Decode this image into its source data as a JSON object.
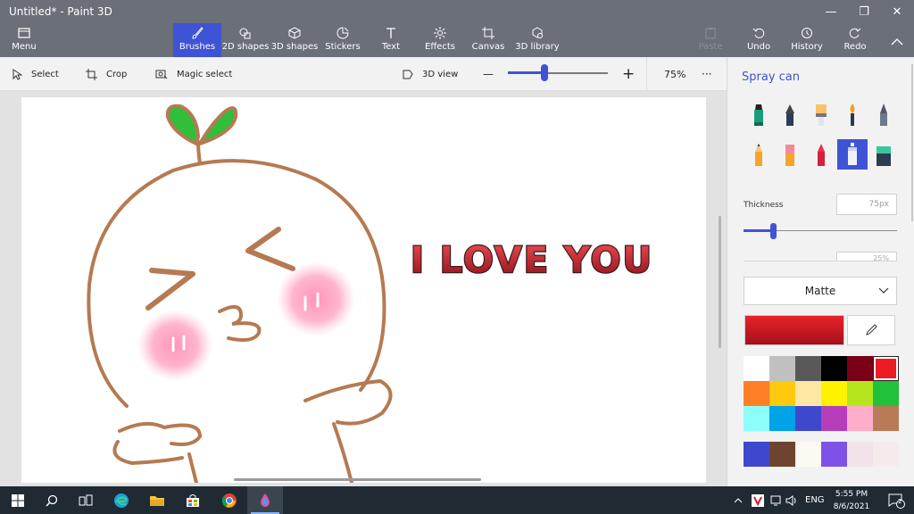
{
  "window": {
    "title": "Untitled* - Paint 3D",
    "minimize_glyph": "—",
    "maximize_glyph": "❐",
    "close_glyph": "✕"
  },
  "ribbon": {
    "menu": "Menu",
    "tabs": [
      "Brushes",
      "2D shapes",
      "3D shapes",
      "Stickers",
      "Text",
      "Effects",
      "Canvas",
      "3D library"
    ],
    "active_tab": "Brushes",
    "paste": "Paste",
    "undo": "Undo",
    "history": "History",
    "redo": "Redo"
  },
  "toolbar": {
    "select": "Select",
    "crop": "Crop",
    "magic_select": "Magic select",
    "view_3d": "3D view",
    "zoom_minus": "—",
    "zoom_plus": "+",
    "zoom_level": "75%",
    "more": "···",
    "zoom_fraction": 0.37
  },
  "canvas": {
    "text_art": "I LOVE YOU"
  },
  "panel": {
    "title": "Spray can",
    "brushes": [
      "marker",
      "calligraphy-pen",
      "oil-brush",
      "watercolor",
      "pixel-pen",
      "pencil",
      "eraser",
      "crayon",
      "spray-can",
      "fill"
    ],
    "selected_brush": "spray-can",
    "thickness_label": "Thickness",
    "thickness_value": "75px",
    "thickness_fraction": 0.2,
    "opacity_peek": "25%",
    "finish": "Matte",
    "current_color": "#e8232a",
    "palette": [
      "#ffffff",
      "#c0c0c0",
      "#595959",
      "#000000",
      "#7a0017",
      "#ed1c24",
      "#ff7f27",
      "#ffc90e",
      "#fce8a3",
      "#fff200",
      "#b5e61d",
      "#22c13c",
      "#8cfffb",
      "#00a2e8",
      "#3f48cc",
      "#b83dba",
      "#ffaec9",
      "#b97a57"
    ],
    "selected_palette_index": 5,
    "custom_colors": [
      "#3f48cc",
      "#6e4430",
      "#fbf9f2",
      "#7e52e6",
      "#f2e3ea",
      "#f5eaec"
    ]
  },
  "taskbar": {
    "language": "ENG",
    "time": "5:55 PM",
    "date": "8/6/2021",
    "notification_count": "2"
  }
}
